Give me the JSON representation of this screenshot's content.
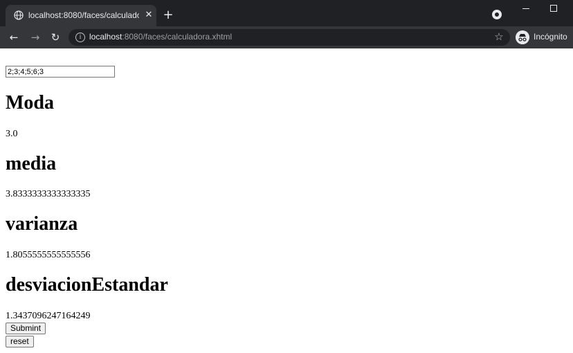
{
  "browser": {
    "tab_title": "localhost:8080/faces/calculadora.xhtml",
    "url_host": "localhost",
    "url_path": ":8080/faces/calculadora.xhtml",
    "profile_label": "Incógnito",
    "icons": {
      "favicon": "globe-icon",
      "close": "close-icon",
      "new_tab": "plus-icon",
      "back": "arrow-left-icon",
      "forward": "arrow-right-icon",
      "reload": "reload-icon",
      "info": "info-icon",
      "bookmark": "star-icon",
      "profile": "incognito-icon"
    },
    "colors": {
      "titlebar": "#202124",
      "toolbar": "#35363a",
      "text": "#e8eaed"
    }
  },
  "form": {
    "input_value": "2;3;4;5;6;3",
    "sections": [
      {
        "heading": "Moda",
        "value": "3.0"
      },
      {
        "heading": "media",
        "value": "3.8333333333333335"
      },
      {
        "heading": "varianza",
        "value": "1.8055555555555556"
      },
      {
        "heading": "desviacionEstandar",
        "value": "1.3437096247164249"
      }
    ],
    "submit_label": "Submint",
    "reset_label": "reset"
  }
}
